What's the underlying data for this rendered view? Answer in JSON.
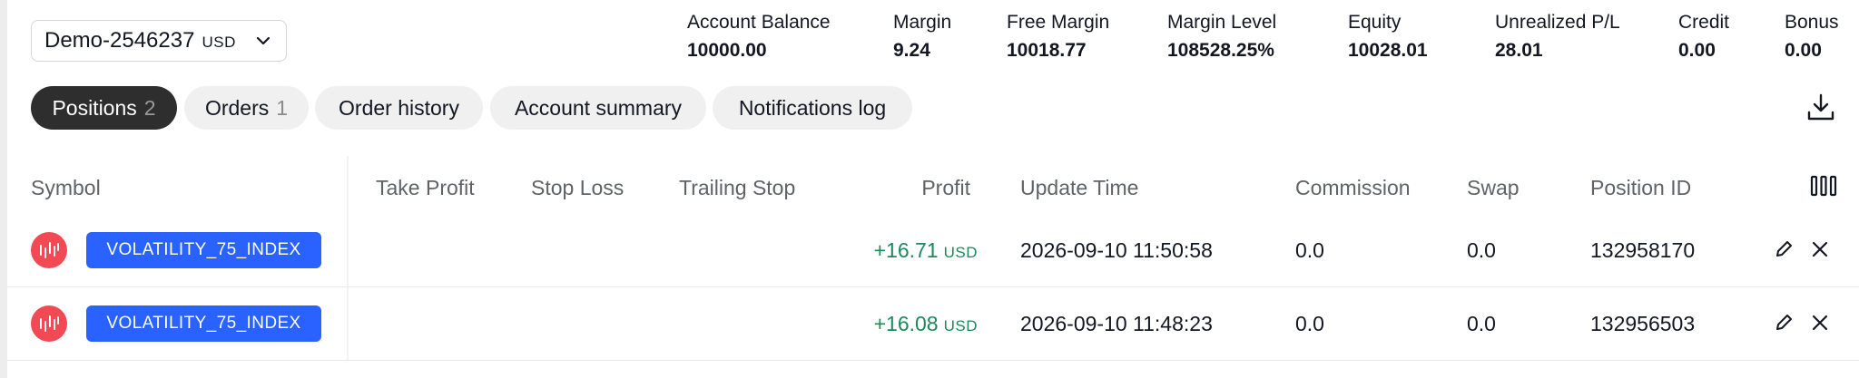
{
  "account": {
    "id": "Demo-2546237",
    "currency": "USD"
  },
  "metrics": [
    {
      "label": "Account Balance",
      "value": "10000.00"
    },
    {
      "label": "Margin",
      "value": "9.24"
    },
    {
      "label": "Free Margin",
      "value": "10018.77"
    },
    {
      "label": "Margin Level",
      "value": "108528.25%"
    },
    {
      "label": "Equity",
      "value": "10028.01"
    },
    {
      "label": "Unrealized P/L",
      "value": "28.01"
    },
    {
      "label": "Credit",
      "value": "0.00"
    },
    {
      "label": "Bonus",
      "value": "0.00"
    }
  ],
  "tabs": [
    {
      "label": "Positions",
      "count": "2",
      "active": true
    },
    {
      "label": "Orders",
      "count": "1",
      "active": false
    },
    {
      "label": "Order history",
      "count": "",
      "active": false
    },
    {
      "label": "Account summary",
      "count": "",
      "active": false
    },
    {
      "label": "Notifications log",
      "count": "",
      "active": false
    }
  ],
  "table": {
    "headers": {
      "symbol": "Symbol",
      "take_profit": "Take Profit",
      "stop_loss": "Stop Loss",
      "trailing_stop": "Trailing Stop",
      "profit": "Profit",
      "update_time": "Update Time",
      "commission": "Commission",
      "swap": "Swap",
      "position_id": "Position ID"
    },
    "rows": [
      {
        "symbol": "VOLATILITY_75_INDEX",
        "profit": "+16.71",
        "profit_currency": "USD",
        "update_time": "2026-09-10 11:50:58",
        "commission": "0.0",
        "swap": "0.0",
        "position_id": "132958170"
      },
      {
        "symbol": "VOLATILITY_75_INDEX",
        "profit": "+16.08",
        "profit_currency": "USD",
        "update_time": "2026-09-10 11:48:23",
        "commission": "0.0",
        "swap": "0.0",
        "position_id": "132956503"
      }
    ]
  },
  "icons": {
    "account_dropdown": "chevron-down-icon",
    "download": "download-icon",
    "columns": "columns-icon",
    "symbol": "volatility-index-icon",
    "edit": "pencil-icon",
    "close": "close-icon"
  },
  "colors": {
    "badge": "#2962ff",
    "profit": "#1b8a5a",
    "symbol_icon": "#f24a55",
    "active_tab": "#2e2e2e"
  }
}
